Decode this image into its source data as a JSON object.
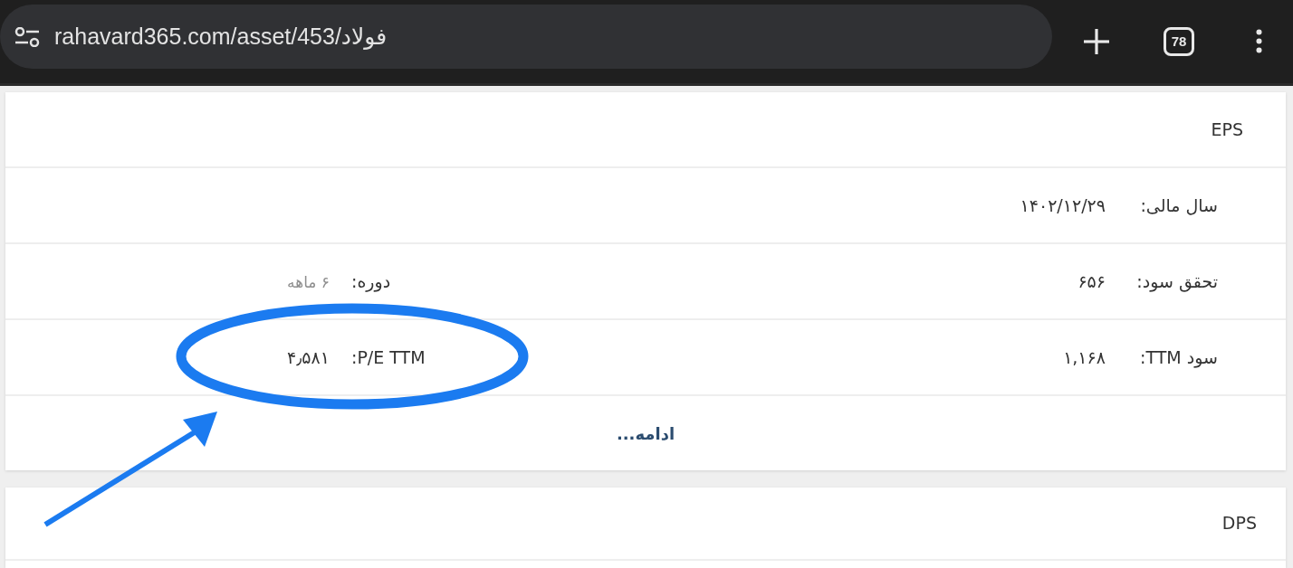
{
  "browser": {
    "url": "rahavard365.com/asset/453/فولاد",
    "tab_count": "78"
  },
  "cards": [
    {
      "title": "EPS",
      "rows": [
        {
          "fields": [
            {
              "label": "سال مالی:",
              "value": "۱۴۰۲/۱۲/۲۹",
              "muted": false
            }
          ]
        },
        {
          "fields": [
            {
              "label": "تحقق سود:",
              "value": "۶۵۶",
              "muted": false
            },
            {
              "label": "دوره:",
              "value": "۶ ماهه",
              "muted": true
            }
          ]
        },
        {
          "fields": [
            {
              "label": "سود TTM:",
              "value": "۱,۱۶۸",
              "muted": false
            },
            {
              "label": "P/E TTM:",
              "value": "۴٫۵۸۱",
              "muted": false
            }
          ]
        }
      ],
      "more_link": "ادامه..."
    },
    {
      "title": "DPS"
    }
  ]
}
